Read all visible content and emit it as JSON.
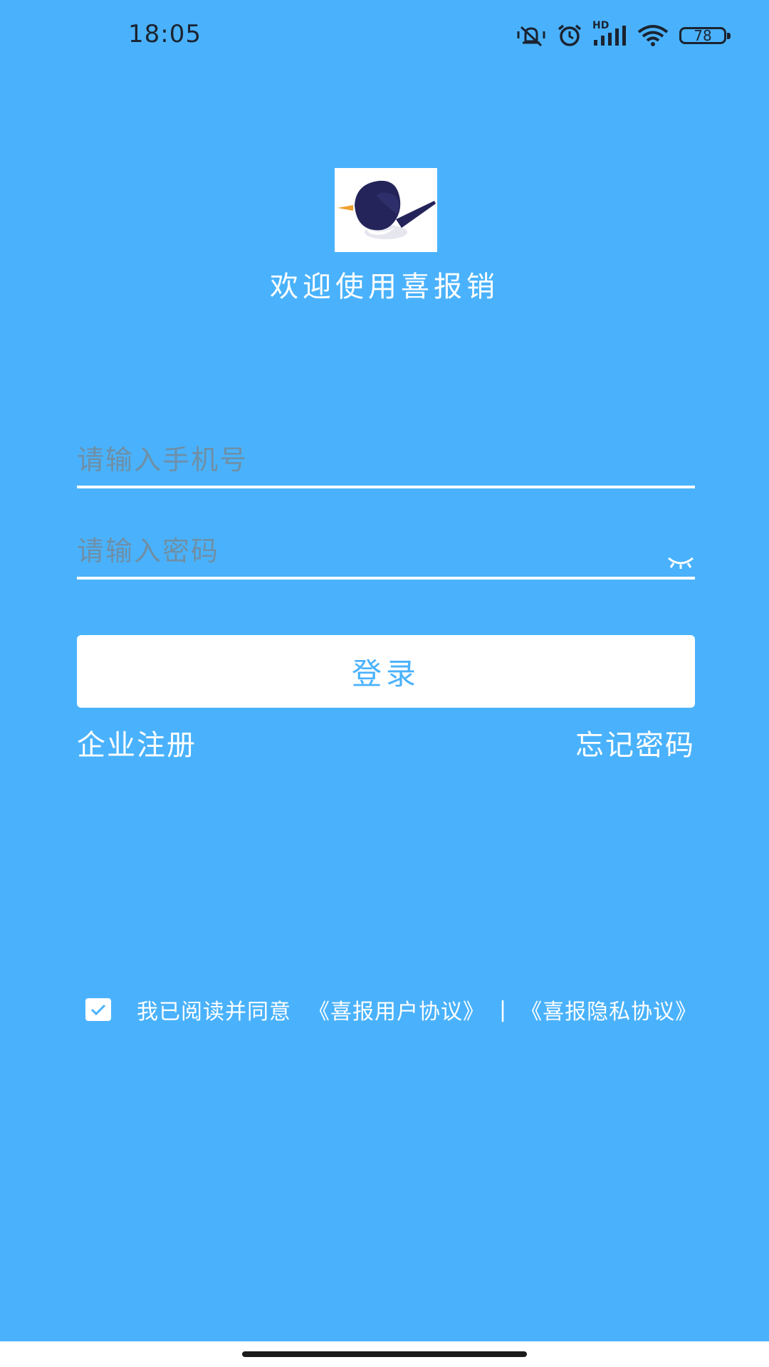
{
  "status_bar": {
    "time": "18:05",
    "network_label": "HD",
    "battery": "78",
    "icons": [
      "mute-vibrate-icon",
      "alarm-icon",
      "signal-icon",
      "wifi-icon",
      "battery-icon"
    ]
  },
  "app": {
    "logo_icon": "bird-logo-icon",
    "title": "欢迎使用喜报销"
  },
  "form": {
    "phone_placeholder": "请输入手机号",
    "phone_value": "",
    "password_placeholder": "请输入密码",
    "password_value": "",
    "password_toggle_icon": "eye-closed-icon",
    "login_label": "登录",
    "register_label": "企业注册",
    "forgot_label": "忘记密码"
  },
  "agreement": {
    "checked": true,
    "text": "我已阅读并同意",
    "user_agreement": "《喜报用户协议》",
    "separator": "|",
    "privacy_agreement": "《喜报隐私协议》"
  },
  "colors": {
    "background": "#4ab2fc",
    "accent": "#4ab2fc",
    "logo_bird": "#24245a",
    "logo_beak": "#f0a030"
  }
}
